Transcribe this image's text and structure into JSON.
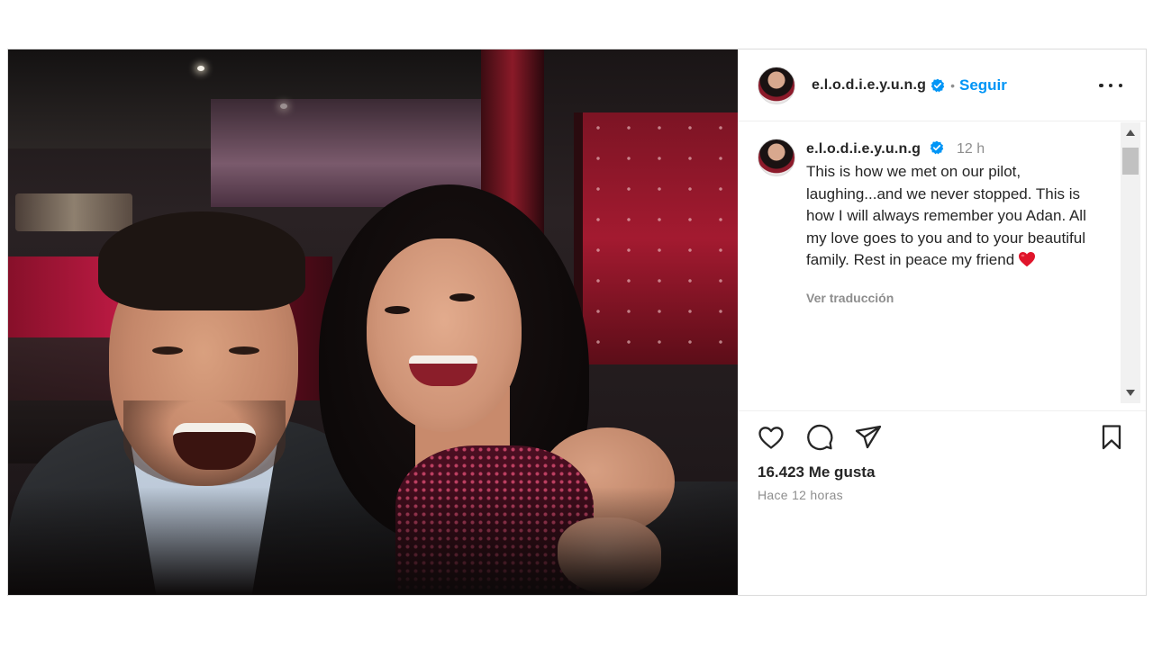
{
  "post": {
    "author": {
      "username": "e.l.o.d.i.e.y.u.n.g",
      "verified": true,
      "avatar_icon": "profile-avatar"
    },
    "follow_label": "Seguir",
    "separator": "•",
    "more_icon": "more-horizontal-icon",
    "photo": {
      "subject": "selfie-photo"
    },
    "caption": {
      "username": "e.l.o.d.i.e.y.u.n.g",
      "time": "12 h",
      "text": "This is how we met on our pilot, laughing...and we never stopped. This is how I will always remember you Adan. All my love goes to you and to your beautiful family. Rest in peace my friend",
      "emoji": "red-heart",
      "translate_label": "Ver traducción"
    },
    "actions": {
      "like_icon": "heart-icon",
      "comment_icon": "comment-icon",
      "share_icon": "share-icon",
      "save_icon": "bookmark-icon"
    },
    "likes_text": "16.423 Me gusta",
    "posted_ago": "Hace 12 horas"
  },
  "colors": {
    "accent": "#0095f6",
    "text": "#262626",
    "secondary_text": "#8e8e8e",
    "border": "#dbdbdb",
    "heart_emoji": "#e0152b"
  }
}
